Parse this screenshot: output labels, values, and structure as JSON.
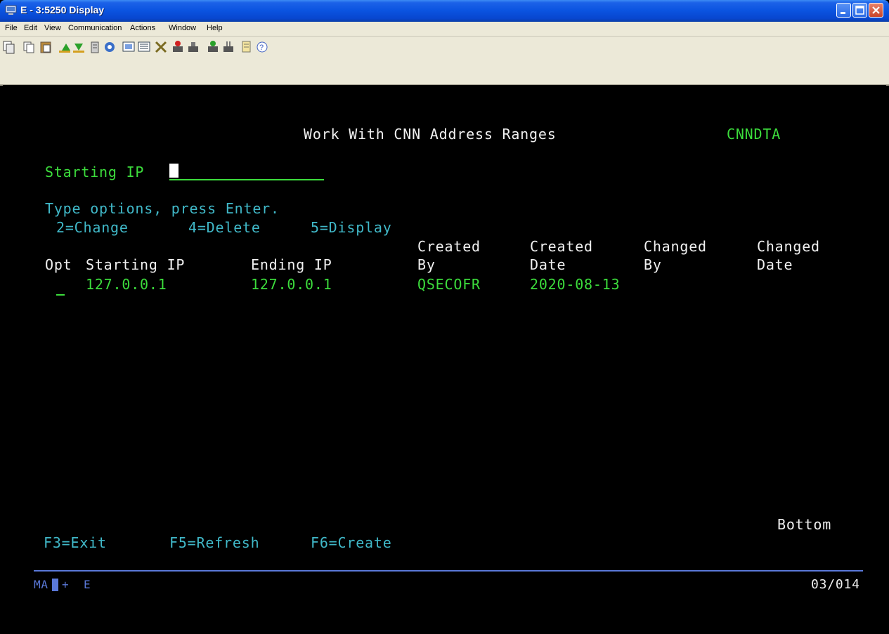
{
  "window": {
    "title": "E - 3:5250 Display"
  },
  "menu": [
    "File",
    "Edit",
    "View",
    "Communication",
    "Actions",
    "Window",
    "Help"
  ],
  "toolbar": {
    "icons": [
      "copy-screen-icon",
      "copy-icon",
      "paste-icon",
      "send-file-icon",
      "receive-file-icon",
      "display-icon",
      "macro-icon",
      "keypad-icon",
      "keyboard-icon",
      "settings-icon",
      "print-icon",
      "print-stop-icon",
      "print-screen-icon",
      "trace-icon",
      "notes-icon",
      "help-icon"
    ]
  },
  "screen": {
    "title": "Work With CNN Address Ranges",
    "library": "CNNDTA",
    "filter": {
      "label": "Starting IP",
      "value": ""
    },
    "instructions": "Type options, press Enter.",
    "options": [
      "2=Change",
      "4=Delete",
      "5=Display"
    ],
    "columns": {
      "opt": "Opt",
      "start_ip": "Starting IP",
      "end_ip": "Ending IP",
      "created_by": [
        "Created",
        "By"
      ],
      "created_date": [
        "Created",
        "Date"
      ],
      "changed_by": [
        "Changed",
        "By"
      ],
      "changed_date": [
        "Changed",
        "Date"
      ]
    },
    "rows": [
      {
        "opt": "",
        "start_ip": "127.0.0.1",
        "end_ip": "127.0.0.1",
        "created_by": "QSECOFR",
        "created_date": "2020-08-13",
        "changed_by": "",
        "changed_date": ""
      }
    ],
    "position": "Bottom",
    "function_keys": [
      "F3=Exit",
      "F5=Refresh",
      "F6=Create"
    ]
  },
  "status": {
    "mode": "MA",
    "plus": "+",
    "session": "E",
    "cursor": "03/014"
  },
  "colors": {
    "background": "#000000",
    "normal": "#f0f0f0",
    "field": "#3cdc3c",
    "instructions": "#40b8c8"
  }
}
